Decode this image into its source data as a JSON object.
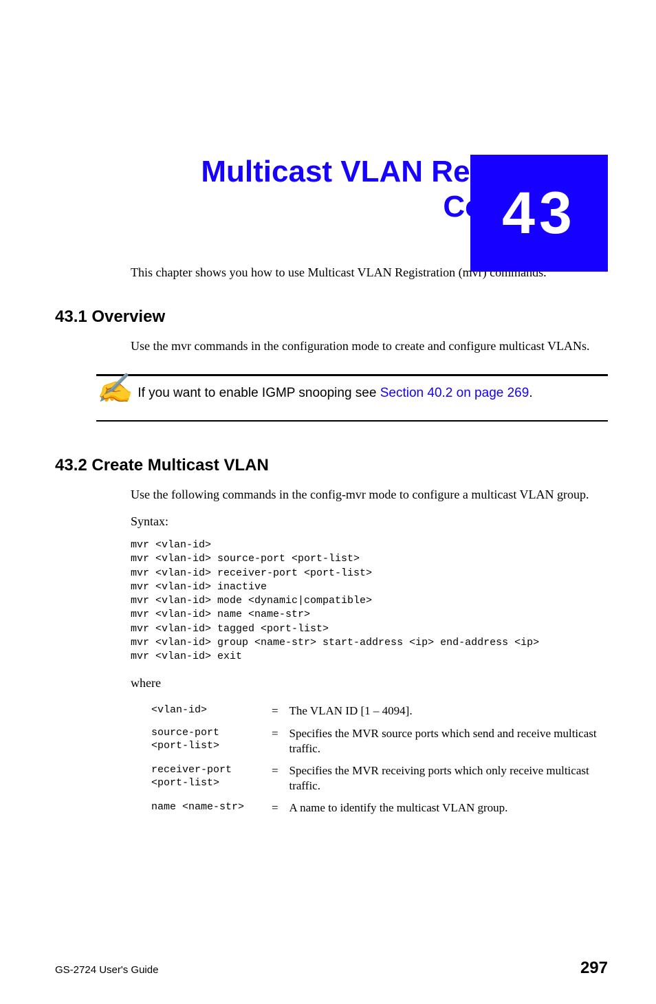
{
  "chapter": {
    "number": "43",
    "title": "Multicast VLAN Registration Commands",
    "intro": "This chapter shows you how to use Multicast VLAN Registration (mvr) commands."
  },
  "sections": {
    "s1": {
      "heading": "43.1  Overview",
      "body": "Use the mvr commands in the configuration mode to create and configure multicast VLANs."
    },
    "note": {
      "text_before_link": "If you want to enable IGMP snooping see ",
      "link_text": "Section 40.2 on page 269",
      "text_after": "."
    },
    "s2": {
      "heading": "43.2  Create Multicast VLAN",
      "body": "Use the following commands in the config-mvr mode to configure a multicast VLAN group.",
      "syntax_label": "Syntax:",
      "syntax": "mvr <vlan-id>\nmvr <vlan-id> source-port <port-list>\nmvr <vlan-id> receiver-port <port-list>\nmvr <vlan-id> inactive\nmvr <vlan-id> mode <dynamic|compatible>\nmvr <vlan-id> name <name-str>\nmvr <vlan-id> tagged <port-list>\nmvr <vlan-id> group <name-str> start-address <ip> end-address <ip>\nmvr <vlan-id> exit",
      "where_label": "where",
      "params": [
        {
          "param": "<vlan-id>",
          "desc": "The VLAN ID [1 – 4094]."
        },
        {
          "param": "source-port\n<port-list>",
          "desc": "Specifies the MVR source ports which send and receive multicast traffic."
        },
        {
          "param": "receiver-port\n<port-list>",
          "desc": "Specifies the MVR receiving ports which only receive multicast traffic."
        },
        {
          "param": "name <name-str>",
          "desc": "A name to identify the multicast VLAN group."
        }
      ]
    }
  },
  "footer": {
    "left": "GS-2724 User's Guide",
    "right": "297"
  }
}
